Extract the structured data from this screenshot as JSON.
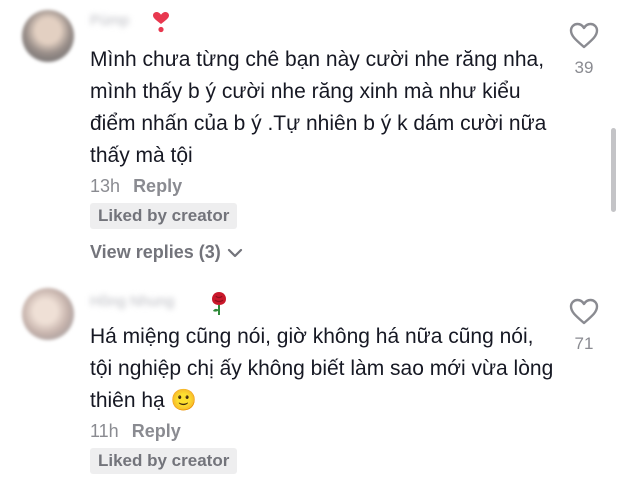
{
  "comments": [
    {
      "username": "Pùmp",
      "badge_emoji": "heart-exclamation-emoji",
      "text": "Mình chưa từng chê bạn này cười nhe răng nha, mình thấy b ý cười nhe răng xinh mà như kiểu điểm nhấn của b ý .Tự nhiên b ý k dám cười nữa thấy mà tội",
      "time": "13h",
      "reply_label": "Reply",
      "liked_badge": "Liked by creator",
      "view_replies": "View replies (3)",
      "likes": "39"
    },
    {
      "username": "Hồng Nhung",
      "badge_emoji": "rose-emoji",
      "text": "Há miệng cũng nói, giờ không há nữa cũng nói, tội nghiệp chị ấy không biết làm sao mới vừa lòng thiên hạ 🙂",
      "time": "11h",
      "reply_label": "Reply",
      "liked_badge": "Liked by creator",
      "likes": "71"
    }
  ],
  "colors": {
    "text": "#161823",
    "secondary": "#8a8b91",
    "badge_bg": "#eeeeef",
    "heart_red": "#e8384f",
    "rose_red": "#c9182b"
  }
}
